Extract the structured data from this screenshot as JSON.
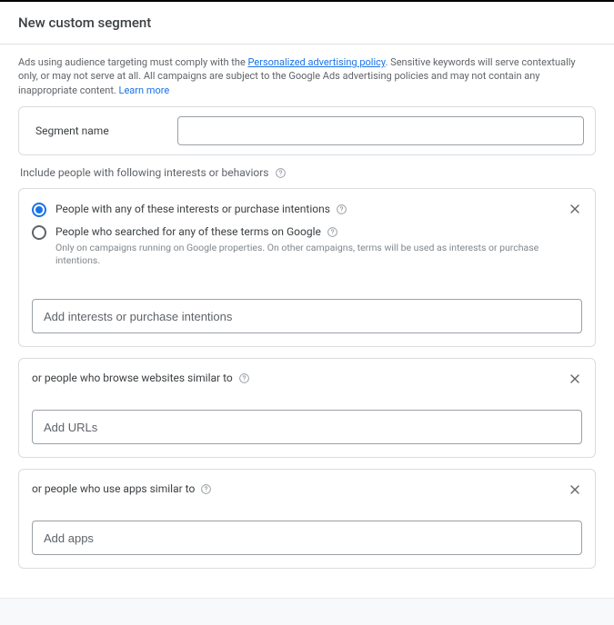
{
  "header": {
    "title": "New custom segment"
  },
  "disclaimer": {
    "text_before": "Ads using audience targeting must comply with the ",
    "policy_link": "Personalized advertising policy",
    "text_after": ". Sensitive keywords will serve contextually only, or may not serve at all. All campaigns are subject to the Google Ads advertising policies and may not contain any inappropriate content. ",
    "learn_more": "Learn more"
  },
  "segment_name": {
    "label": "Segment name",
    "value": ""
  },
  "include_label": "Include people with following interests or behaviors",
  "interests": {
    "radios": [
      {
        "label": "People with any of these interests or purchase intentions",
        "help": ""
      },
      {
        "label": "People who searched for any of these terms on Google",
        "help": "Only on campaigns running on Google properties. On other campaigns, terms will be used as interests or purchase intentions."
      }
    ],
    "input_placeholder": "Add interests or purchase intentions"
  },
  "websites": {
    "title": "or people who browse websites similar to",
    "input_placeholder": "Add URLs"
  },
  "apps": {
    "title": "or people who use apps similar to",
    "input_placeholder": "Add apps"
  }
}
